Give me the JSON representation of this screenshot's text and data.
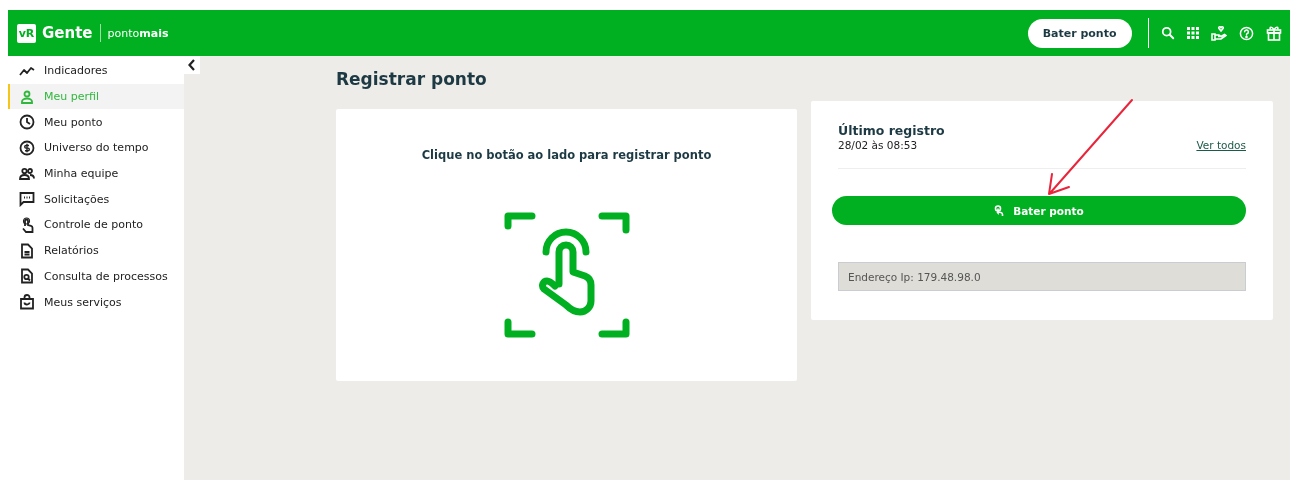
{
  "header": {
    "logo_badge": "vR",
    "logo_name": "Gente",
    "logo_product": "ponto**mais**",
    "punch_button": "Bater ponto"
  },
  "sidebar": {
    "items": [
      {
        "label": "Indicadores",
        "selected": false
      },
      {
        "label": "Meu perfil",
        "selected": true
      },
      {
        "label": "Meu ponto",
        "selected": false
      },
      {
        "label": "Universo do tempo",
        "selected": false
      },
      {
        "label": "Minha equipe",
        "selected": false
      },
      {
        "label": "Solicitações",
        "selected": false
      },
      {
        "label": "Controle de ponto",
        "selected": false
      },
      {
        "label": "Relatórios",
        "selected": false
      },
      {
        "label": "Consulta de processos",
        "selected": false
      },
      {
        "label": "Meus serviços",
        "selected": false
      }
    ]
  },
  "page_title": "Registrar ponto",
  "instruction_card": {
    "text": "Clique no botão ao lado para registrar ponto"
  },
  "last_record_card": {
    "title": "Último registro",
    "datetime": "28/02 às 08:53",
    "see_all_link": "Ver todos",
    "punch_button": "Bater ponto",
    "ip_field": "Endereço Ip: 179.48.98.0"
  }
}
